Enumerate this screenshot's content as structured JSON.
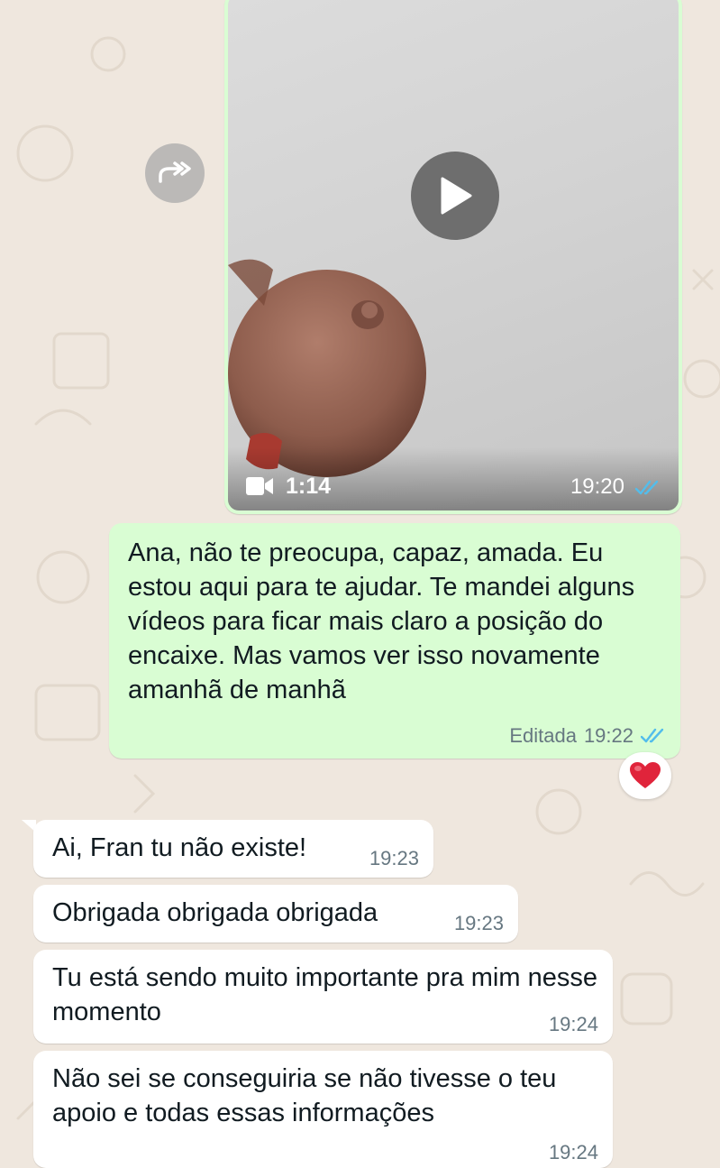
{
  "icons": {
    "forward": "forward-icon",
    "play": "play-icon",
    "video_camera": "video-camera-icon",
    "read_receipt": "double-check-icon",
    "reaction": "heart-icon"
  },
  "colors": {
    "outgoing_bubble": "#d9fdd3",
    "incoming_bubble": "#ffffff",
    "read_receipt": "#53bdeb",
    "heart": "#e0243b"
  },
  "video_message": {
    "duration": "1:14",
    "time": "19:20"
  },
  "outgoing_message": {
    "text": "Ana, não te preocupa, capaz, amada. Eu estou aqui para te ajudar. Te mandei alguns vídeos para ficar mais claro a posição do encaixe. Mas vamos ver isso novamente amanhã de manhã",
    "edited_label": "Editada",
    "time": "19:22",
    "reaction": "❤️"
  },
  "incoming_messages": [
    {
      "text": "Ai, Fran tu não existe!",
      "time": "19:23"
    },
    {
      "text": "Obrigada obrigada obrigada",
      "time": "19:23"
    },
    {
      "text": "Tu está sendo muito importante pra mim nesse momento",
      "time": "19:24"
    },
    {
      "text": "Não sei se conseguiria se não tivesse o teu apoio e todas essas informações",
      "time": "19:24"
    }
  ]
}
